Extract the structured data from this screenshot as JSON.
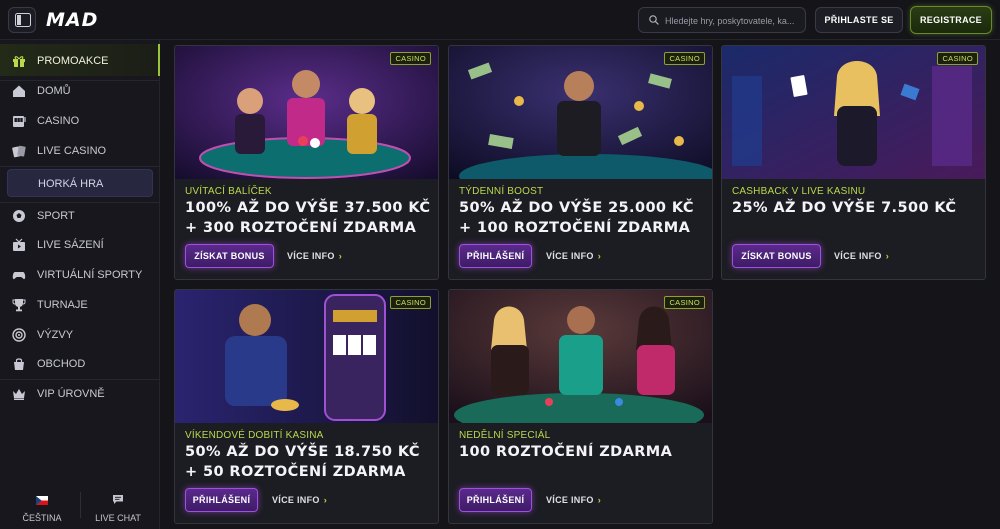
{
  "header": {
    "logo": "MAD",
    "search_placeholder": "Hledejte hry, poskytovatele, ka...",
    "login_label": "PŘIHLASTE SE",
    "register_label": "REGISTRACE"
  },
  "sidebar": {
    "items": [
      {
        "label": "PROMOAKCE",
        "icon": "gift-icon"
      },
      {
        "label": "DOMŮ",
        "icon": "home-icon"
      },
      {
        "label": "CASINO",
        "icon": "slot-machine-icon"
      },
      {
        "label": "LIVE CASINO",
        "icon": "cards-icon"
      },
      {
        "label": "HORKÁ HRA",
        "icon": ""
      },
      {
        "label": "SPORT",
        "icon": "soccer-ball-icon"
      },
      {
        "label": "LIVE SÁZENÍ",
        "icon": "tv-icon"
      },
      {
        "label": "VIRTUÁLNÍ SPORTY",
        "icon": "gamepad-icon"
      },
      {
        "label": "TURNAJE",
        "icon": "trophy-icon"
      },
      {
        "label": "VÝZVY",
        "icon": "target-icon"
      },
      {
        "label": "OBCHOD",
        "icon": "shopping-bag-icon"
      },
      {
        "label": "VIP ÚROVNĚ",
        "icon": "crown-icon"
      }
    ],
    "footer": {
      "language_label": "ČEŠTINA",
      "chat_label": "LIVE CHAT"
    }
  },
  "promotions": [
    {
      "badge": "CASINO",
      "subtitle": "UVÍTACÍ BALÍČEK",
      "title": "100% AŽ DO VÝŠE 37.500 KČ + 300 ROZTOČENÍ ZDARMA",
      "cta": "ZÍSKAT BONUS",
      "more": "VÍCE INFO"
    },
    {
      "badge": "CASINO",
      "subtitle": "TÝDENNÍ BOOST",
      "title": "50% AŽ DO VÝŠE 25.000 KČ + 100 ROZTOČENÍ ZDARMA",
      "cta": "PŘIHLÁŠENÍ",
      "more": "VÍCE INFO"
    },
    {
      "badge": "CASINO",
      "subtitle": "CASHBACK V LIVE KASINU",
      "title": "25% AŽ DO VÝŠE 7.500 KČ",
      "cta": "ZÍSKAT BONUS",
      "more": "VÍCE INFO"
    },
    {
      "badge": "CASINO",
      "subtitle": "VÍKENDOVÉ DOBITÍ KASINA",
      "title": "50% AŽ DO VÝŠE 18.750 KČ + 50 ROZTOČENÍ ZDARMA",
      "cta": "PŘIHLÁŠENÍ",
      "more": "VÍCE INFO"
    },
    {
      "badge": "CASINO",
      "subtitle": "NEDĚLNÍ SPECIÁL",
      "title": "100 ROZTOČENÍ ZDARMA",
      "cta": "PŘIHLÁŠENÍ",
      "more": "VÍCE INFO"
    }
  ],
  "colors": {
    "accent_green": "#b9d94b",
    "accent_purple": "#a24ee0",
    "background": "#141419"
  }
}
